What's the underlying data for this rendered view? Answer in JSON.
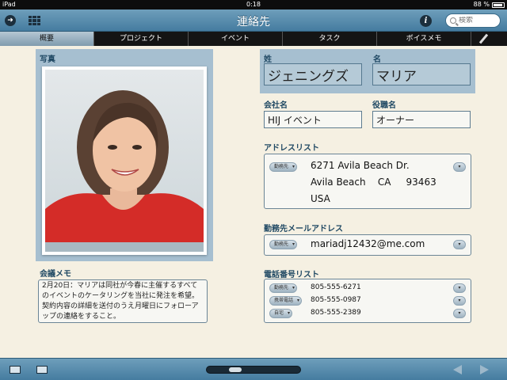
{
  "status": {
    "device": "iPad",
    "time": "0:18",
    "battery": "88 %"
  },
  "nav": {
    "title": "連絡先",
    "search_placeholder": "検索",
    "back_icon": "arrow-circle-icon",
    "grid_icon": "grid-list-icon",
    "info_icon": "info-icon"
  },
  "tabs": [
    {
      "label": "概要",
      "active": true
    },
    {
      "label": "プロジェクト",
      "active": false
    },
    {
      "label": "イベント",
      "active": false
    },
    {
      "label": "タスク",
      "active": false
    },
    {
      "label": "ボイスメモ",
      "active": false
    }
  ],
  "photo": {
    "label": "写真"
  },
  "name": {
    "last_label": "姓",
    "first_label": "名",
    "last": "ジェニングズ",
    "first": "マリア"
  },
  "company": {
    "company_label": "会社名",
    "title_label": "役職名",
    "company": "HIJ イベント",
    "title": "オーナー"
  },
  "address": {
    "label": "アドレスリスト",
    "type": "勤務先",
    "line1": "6271 Avila Beach Dr.",
    "line2": "Avila Beach    CA     93463",
    "line3": "USA"
  },
  "email": {
    "label": "勤務先メールアドレス",
    "type": "勤務先",
    "value": "mariadj12432@me.com"
  },
  "phones": {
    "label": "電話番号リスト",
    "items": [
      {
        "type": "勤務先",
        "number": "805-555-6271"
      },
      {
        "type": "携帯電話",
        "number": "805-555-0987"
      },
      {
        "type": "自宅",
        "number": "805-555-2389"
      }
    ]
  },
  "memo": {
    "label": "会議メモ",
    "text": "2月20日：マリアは同社が今春に主催するすべてのイベントのケータリングを当社に発注を希望。契約内容の詳細を送付のうえ月曜日にフォローアップの連絡をすること。"
  },
  "colors": {
    "nav": "#457ca0",
    "panel": "#a6bfd0",
    "background": "#f5f0e2",
    "label": "#1f4863"
  }
}
